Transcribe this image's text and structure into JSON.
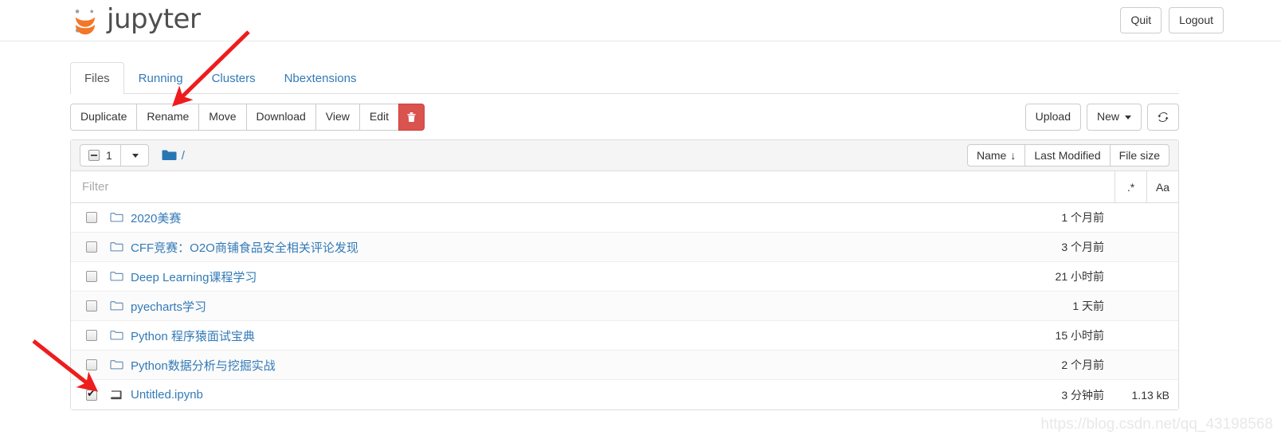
{
  "header": {
    "brand": "jupyter",
    "quit_label": "Quit",
    "logout_label": "Logout"
  },
  "tabs": [
    {
      "label": "Files",
      "active": true
    },
    {
      "label": "Running",
      "active": false
    },
    {
      "label": "Clusters",
      "active": false
    },
    {
      "label": "Nbextensions",
      "active": false
    }
  ],
  "toolbar": {
    "duplicate_label": "Duplicate",
    "rename_label": "Rename",
    "move_label": "Move",
    "download_label": "Download",
    "view_label": "View",
    "edit_label": "Edit",
    "delete_icon": "trash-icon",
    "delete_glyph": "🗑",
    "upload_label": "Upload",
    "new_label": "New",
    "refresh_icon": "refresh-icon",
    "refresh_glyph": "⟳"
  },
  "list_header": {
    "selected_count": "1",
    "select_checkbox_state": "indeterminate",
    "breadcrumb_root": "/",
    "folder_icon": "folder-icon",
    "sort_name_label": "Name",
    "sort_name_arrow": "↓",
    "sort_modified_label": "Last Modified",
    "sort_size_label": "File size"
  },
  "filter": {
    "value": "",
    "placeholder": "Filter",
    "regex_toggle_label": ".*",
    "case_toggle_label": "Aa"
  },
  "files": [
    {
      "name": "2020美赛",
      "type": "folder",
      "modified": "1 个月前",
      "size": "",
      "checked": false
    },
    {
      "name": "CFF竞赛：O2O商铺食品安全相关评论发现",
      "type": "folder",
      "modified": "3 个月前",
      "size": "",
      "checked": false
    },
    {
      "name": "Deep Learning课程学习",
      "type": "folder",
      "modified": "21 小时前",
      "size": "",
      "checked": false
    },
    {
      "name": "pyecharts学习",
      "type": "folder",
      "modified": "1 天前",
      "size": "",
      "checked": false
    },
    {
      "name": "Python 程序猿面试宝典",
      "type": "folder",
      "modified": "15 小时前",
      "size": "",
      "checked": false
    },
    {
      "name": "Python数据分析与挖掘实战",
      "type": "folder",
      "modified": "2 个月前",
      "size": "",
      "checked": false
    },
    {
      "name": "Untitled.ipynb",
      "type": "notebook",
      "modified": "3 分钟前",
      "size": "1.13 kB",
      "checked": true
    }
  ],
  "annotations": {
    "arrow_color": "#ee1c1c",
    "arrow_rename_target": "rename-button",
    "arrow_checkbox_target": "row-checkbox-untitled"
  },
  "watermark": {
    "text": "https://blog.csdn.net/qq_43198568"
  },
  "colors": {
    "link": "#337ab7",
    "danger": "#d9534f",
    "folder": "#337ab7",
    "annotation": "#ee1c1c"
  }
}
